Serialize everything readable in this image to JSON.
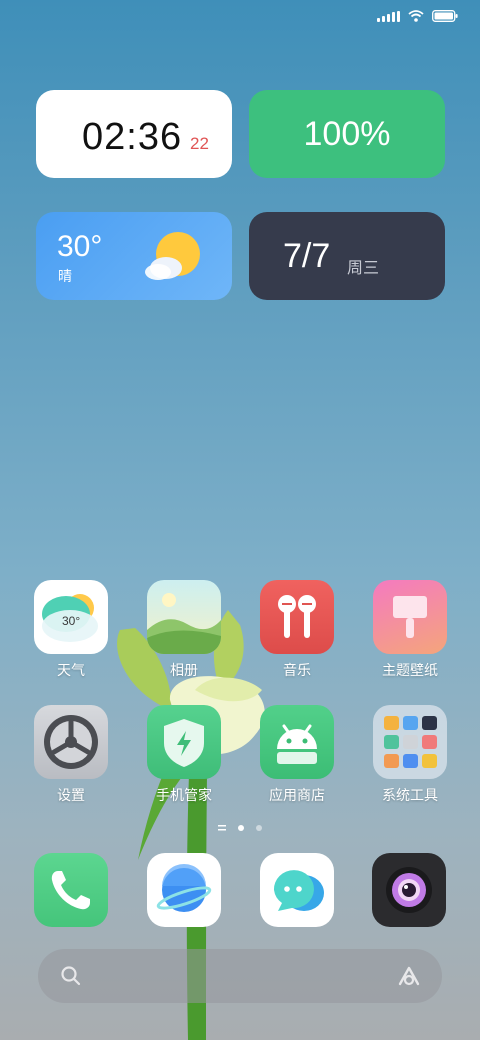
{
  "status_bar": {
    "signal_icon": "signal-icon",
    "wifi_icon": "wifi-icon",
    "battery_icon": "battery-icon"
  },
  "widgets": {
    "clock": {
      "time": "02:36",
      "seconds": "22"
    },
    "battery": {
      "value": "100%"
    },
    "weather": {
      "temperature": "30°",
      "condition": "晴",
      "icon": "partly-sunny-icon"
    },
    "date": {
      "date": "7/7",
      "weekday": "周三"
    }
  },
  "apps": [
    {
      "label": "天气",
      "icon": "weather-app-icon",
      "badge": "30°"
    },
    {
      "label": "相册",
      "icon": "gallery-app-icon"
    },
    {
      "label": "音乐",
      "icon": "music-app-icon"
    },
    {
      "label": "主题壁纸",
      "icon": "themes-app-icon"
    },
    {
      "label": "设置",
      "icon": "settings-gear-icon"
    },
    {
      "label": "手机管家",
      "icon": "security-shield-icon"
    },
    {
      "label": "应用商店",
      "icon": "android-app-store-icon"
    },
    {
      "label": "系统工具",
      "icon": "system-tools-folder-icon"
    }
  ],
  "page_indicator": {
    "pages": 2,
    "current": 1
  },
  "dock": [
    {
      "name": "phone",
      "icon": "phone-icon"
    },
    {
      "name": "browser",
      "icon": "browser-planet-icon"
    },
    {
      "name": "messages",
      "icon": "messages-icon"
    },
    {
      "name": "camera",
      "icon": "camera-icon"
    }
  ],
  "search_bar": {
    "left_icon": "search-icon",
    "right_icon": "assistant-icon"
  },
  "colors": {
    "battery_widget": "#3dc07e",
    "date_widget": "#363b4c",
    "weather_widget": "#4a9ef2",
    "clock_seconds": "#e05555"
  }
}
